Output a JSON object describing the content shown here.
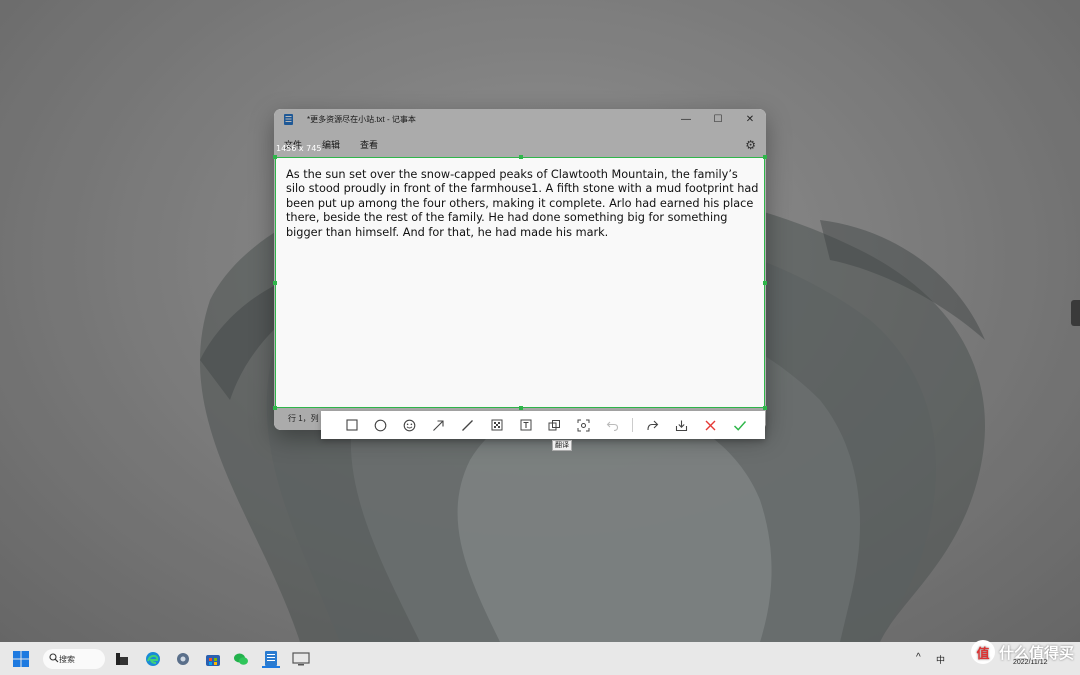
{
  "notepad": {
    "title": "*更多资源尽在小站.txt - 记事本",
    "menu": [
      "文件",
      "编辑",
      "查看"
    ],
    "status_left": "行 1，列",
    "icon": "notepad-icon",
    "controls": {
      "minimize": "—",
      "maximize": "☐",
      "close": "✕"
    }
  },
  "selection": {
    "size_label": "1456 x 745",
    "text": "As the sun set over the snow-capped peaks of Clawtooth Mountain, the family’s silo stood proudly in front of the farmhouse1. A fifth stone with a mud footprint had been put up among the four others, making it complete. Arlo had earned his place there, beside the rest of the family. He had done something big for something bigger than himself. And for that, he had made his mark.",
    "border_color": "#2fb64a"
  },
  "toolbar": {
    "tools": [
      {
        "name": "rectangle-icon"
      },
      {
        "name": "ellipse-icon"
      },
      {
        "name": "emoji-icon"
      },
      {
        "name": "arrow-icon"
      },
      {
        "name": "line-icon"
      },
      {
        "name": "mosaic-icon"
      },
      {
        "name": "text-icon"
      },
      {
        "name": "pin-icon"
      },
      {
        "name": "ocr-icon"
      },
      {
        "name": "undo-icon"
      },
      {
        "name": "share-icon"
      },
      {
        "name": "save-icon"
      },
      {
        "name": "cancel-icon",
        "color": "#e53935"
      },
      {
        "name": "confirm-icon",
        "color": "#2fb64a"
      }
    ],
    "tooltip": "翻译"
  },
  "taskbar": {
    "search_label": "搜索",
    "apps": [
      "start-icon",
      "file-explorer-icon",
      "edge-icon",
      "settings-icon",
      "store-icon",
      "wechat-icon",
      "notepad-icon",
      "screenshot-app-icon"
    ],
    "ime": "中",
    "chevron": "^",
    "date": "2022/11/12"
  },
  "watermark": {
    "logo_char": "值",
    "text": "什么值得买"
  }
}
